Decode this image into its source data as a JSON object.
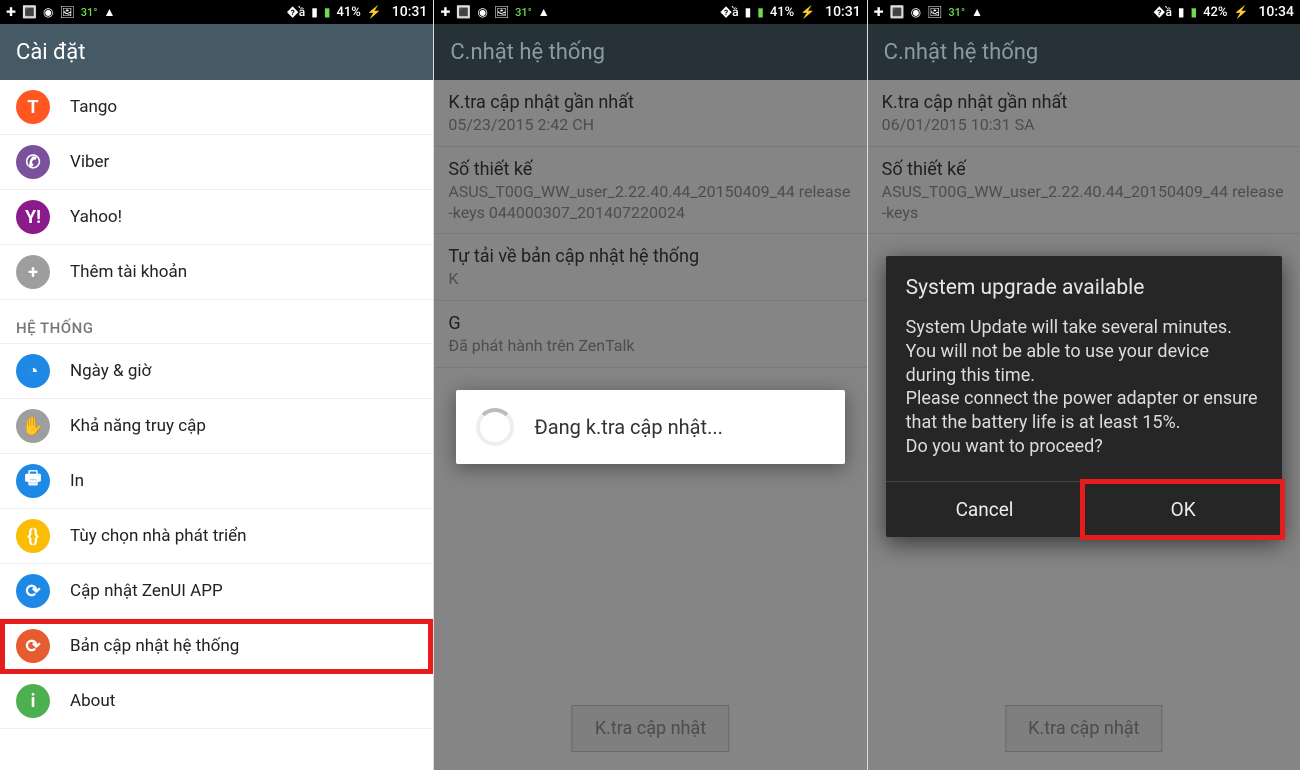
{
  "panel1": {
    "status": {
      "temp": "31°",
      "battery_pct": "41%",
      "time": "10:31"
    },
    "header": "Cài đặt",
    "items": [
      {
        "label": "Tango",
        "icon_name": "tango-icon",
        "icon_bg": "#ff5722",
        "icon_txt": "T"
      },
      {
        "label": "Viber",
        "icon_name": "viber-icon",
        "icon_bg": "#7b519d",
        "icon_txt": "✆"
      },
      {
        "label": "Yahoo!",
        "icon_name": "yahoo-icon",
        "icon_bg": "#8b1b8b",
        "icon_txt": "Y!"
      },
      {
        "label": "Thêm tài khoản",
        "icon_name": "add-account-icon",
        "icon_bg": "#9e9e9e",
        "icon_txt": "+"
      }
    ],
    "section": "HỆ THỐNG",
    "sysitems": [
      {
        "label": "Ngày & giờ",
        "icon_name": "clock-icon",
        "icon_bg": "#1e88e5",
        "icon_txt": "◔"
      },
      {
        "label": "Khả năng truy cập",
        "icon_name": "accessibility-icon",
        "icon_bg": "#9e9e9e",
        "icon_txt": "✋"
      },
      {
        "label": "In",
        "icon_name": "print-icon",
        "icon_bg": "#1e88e5",
        "icon_txt": "🖶"
      },
      {
        "label": "Tùy chọn nhà phát triển",
        "icon_name": "developer-icon",
        "icon_bg": "#fbbc04",
        "icon_txt": "{}"
      },
      {
        "label": "Cập nhật ZenUI APP",
        "icon_name": "zenui-update-icon",
        "icon_bg": "#1e88e5",
        "icon_txt": "⟳"
      },
      {
        "label": "Bản cập nhật hệ thống",
        "icon_name": "system-update-icon",
        "icon_bg": "#e65c30",
        "icon_txt": "⟳",
        "highlight": true
      },
      {
        "label": "About",
        "icon_name": "about-icon",
        "icon_bg": "#4caf50",
        "icon_txt": "i"
      }
    ]
  },
  "panel2": {
    "status": {
      "temp": "31°",
      "battery_pct": "41%",
      "time": "10:31"
    },
    "header": "C.nhật hệ thống",
    "blocks": [
      {
        "title": "K.tra cập nhật gần nhất",
        "body": "05/23/2015 2:42 CH"
      },
      {
        "title": "Số thiết kế",
        "body": "ASUS_T00G_WW_user_2.22.40.44_20150409_44 release-keys\n044000307_201407220024"
      },
      {
        "title": "Tự tải về bản cập nhật hệ thống",
        "body": "K"
      },
      {
        "title": "G",
        "body": "Đã phát hành trên ZenTalk"
      }
    ],
    "check_button": "K.tra cập nhật",
    "loading_text": "Đang k.tra cập nhật..."
  },
  "panel3": {
    "status": {
      "temp": "31°",
      "battery_pct": "42%",
      "time": "10:34"
    },
    "header": "C.nhật hệ thống",
    "blocks": [
      {
        "title": "K.tra cập nhật gần nhất",
        "body": "06/01/2015 10:31 SA"
      },
      {
        "title": "Số thiết kế",
        "body": "ASUS_T00G_WW_user_2.22.40.44_20150409_44 release-keys"
      }
    ],
    "check_button": "K.tra cập nhật",
    "dialog": {
      "title": "System upgrade available",
      "body": "System Update will take several minutes. You will not be able to use your device during this time.\nPlease connect the power adapter or ensure that the battery life is at least 15%.\nDo you want to proceed?",
      "cancel": "Cancel",
      "ok": "OK"
    }
  }
}
